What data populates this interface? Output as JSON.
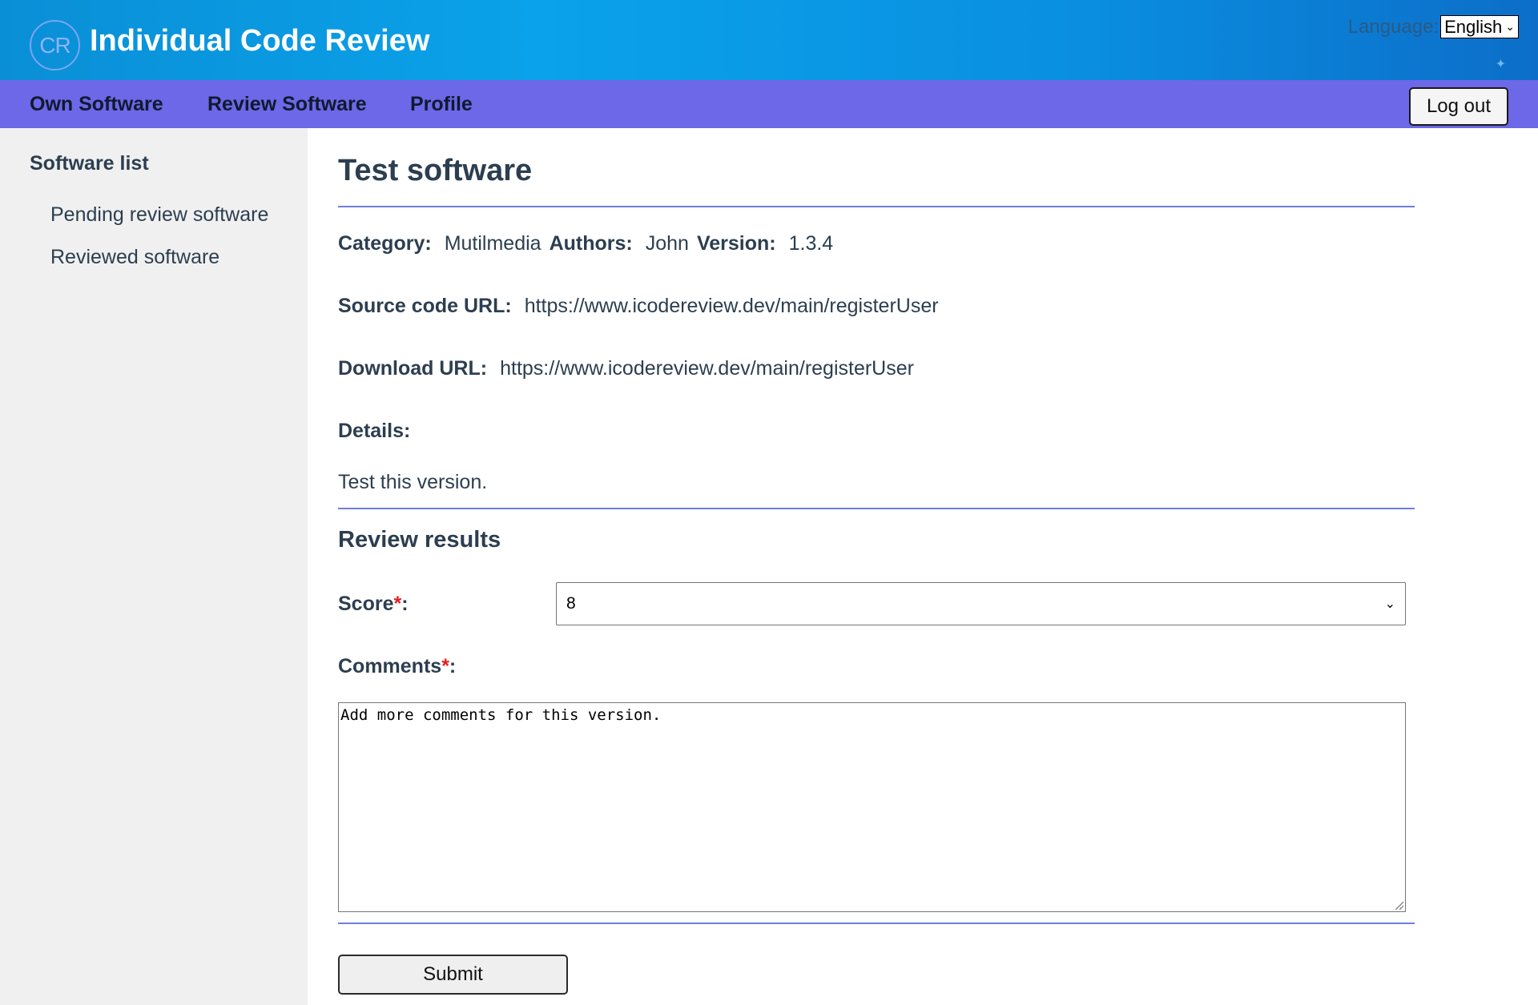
{
  "header": {
    "logo_text": "CR",
    "app_title": "Individual Code Review",
    "language_label": "Language:",
    "language_value": "English"
  },
  "nav": {
    "items": [
      "Own Software",
      "Review Software",
      "Profile"
    ],
    "logout_label": "Log out"
  },
  "sidebar": {
    "title": "Software list",
    "links": [
      "Pending review software",
      "Reviewed software"
    ]
  },
  "software": {
    "title": "Test software",
    "category_label": "Category:",
    "category": "Mutilmedia",
    "authors_label": "Authors:",
    "authors": "John",
    "version_label": "Version:",
    "version": "1.3.4",
    "source_label": "Source code URL:",
    "source_url": "https://www.icodereview.dev/main/registerUser",
    "download_label": "Download URL:",
    "download_url": "https://www.icodereview.dev/main/registerUser",
    "details_label": "Details:",
    "details": "Test this version."
  },
  "review": {
    "title": "Review results",
    "score_label": "Score",
    "score_value": "8",
    "comments_label": "Comments",
    "required_mark": "*",
    "colon": ":",
    "comments_value": "Add more comments for this version.",
    "submit_label": "Submit"
  }
}
